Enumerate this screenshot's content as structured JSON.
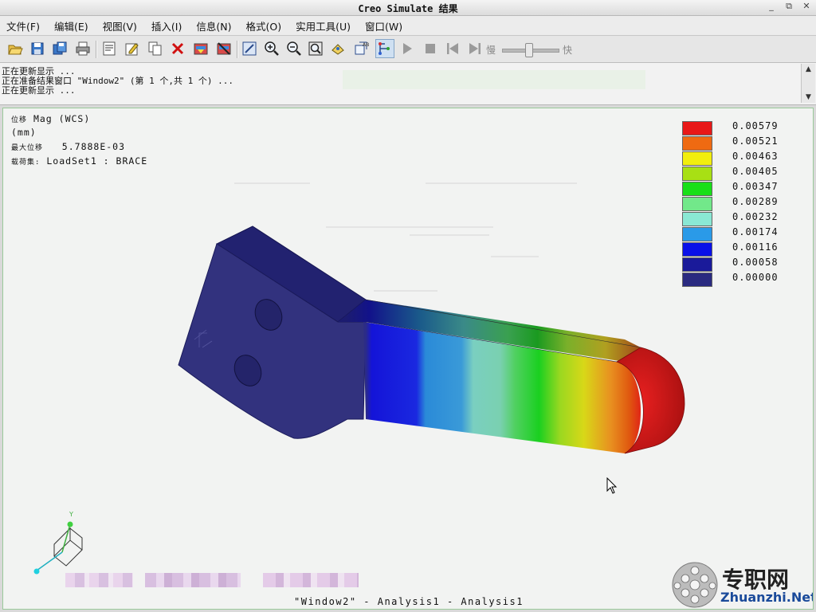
{
  "window": {
    "title": "Creo Simulate 结果",
    "minimize": "_",
    "restore": "⧉",
    "close": "✕"
  },
  "menu": [
    "文件(F)",
    "编辑(E)",
    "视图(V)",
    "插入(I)",
    "信息(N)",
    "格式(O)",
    "实用工具(U)",
    "窗口(W)"
  ],
  "toolbar": {
    "icons": [
      "open-icon",
      "save-icon",
      "save-copy-icon",
      "print-icon",
      "report-icon",
      "edit-icon",
      "copy-icon",
      "delete-icon",
      "show-icon",
      "hide-icon",
      "fit-window-icon",
      "zoom-in-icon",
      "zoom-out-icon",
      "refit-icon",
      "spin-icon",
      "orient-icon",
      "model-tree-icon",
      "play-icon",
      "stop-icon",
      "first-frame-icon",
      "last-frame-icon"
    ],
    "slow_label": "慢",
    "fast_label": "快"
  },
  "messages": [
    "正在更新显示 ...",
    "正在准备结果窗口 \"Window2\" (第 1 个,共 1 个) ...",
    "正在更新显示 ..."
  ],
  "result_info": {
    "quantity_prefix": "位移",
    "quantity": "Mag (WCS)",
    "units": "(mm)",
    "max_label": "最大位移",
    "max_value": "5.7888E-03",
    "load_label": "载荷集:",
    "load_value": "LoadSet1 :  BRACE"
  },
  "legend": {
    "values": [
      "0.00579",
      "0.00521",
      "0.00463",
      "0.00405",
      "0.00347",
      "0.00289",
      "0.00232",
      "0.00174",
      "0.00116",
      "0.00058",
      "0.00000"
    ],
    "colors": [
      "#e81818",
      "#ef6a12",
      "#f2ee0e",
      "#a8e014",
      "#18df18",
      "#72e88a",
      "#8ae8d4",
      "#2a9ae8",
      "#0a10e8",
      "#1a1a9a",
      "#2a2a80"
    ]
  },
  "window_caption": "\"Window2\" - Analysis1 - Analysis1",
  "watermark": {
    "cn": "专职网",
    "en": "Zhuanzhi.Net"
  }
}
